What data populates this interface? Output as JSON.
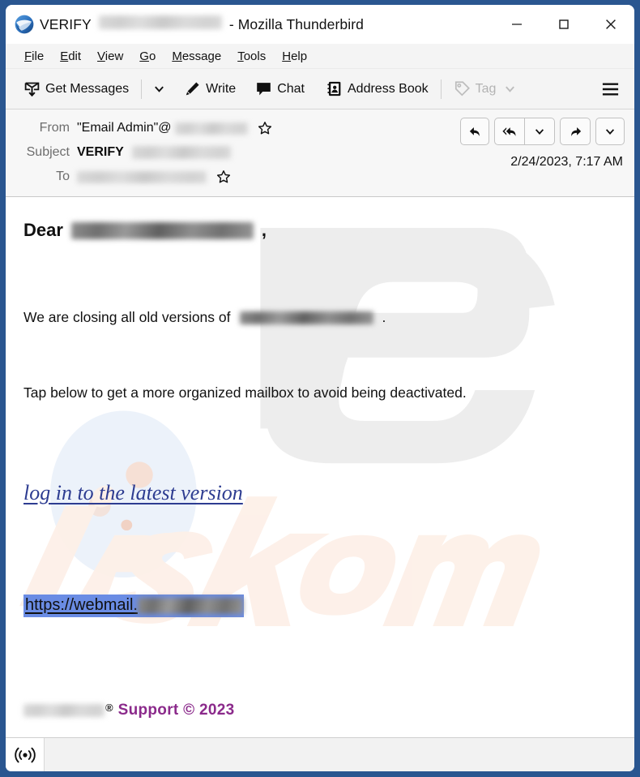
{
  "window": {
    "title_prefix": "VERIFY",
    "title_suffix": "- Mozilla Thunderbird",
    "app_icon": "thunderbird-logo-icon",
    "border_color": "#2a5690",
    "controls": {
      "minimize": "minimize-icon",
      "maximize": "maximize-icon",
      "close": "close-icon"
    }
  },
  "menubar": {
    "items": [
      {
        "label": "File",
        "accel": "F"
      },
      {
        "label": "Edit",
        "accel": "E"
      },
      {
        "label": "View",
        "accel": "V"
      },
      {
        "label": "Go",
        "accel": "G"
      },
      {
        "label": "Message",
        "accel": "M"
      },
      {
        "label": "Tools",
        "accel": "T"
      },
      {
        "label": "Help",
        "accel": "H"
      }
    ]
  },
  "toolbar": {
    "get_messages": "Get Messages",
    "get_messages_icon": "download-mail-icon",
    "get_messages_caret": "chevron-down-icon",
    "write": "Write",
    "write_icon": "pencil-icon",
    "chat": "Chat",
    "chat_icon": "speech-bubble-icon",
    "address_book": "Address Book",
    "address_book_icon": "address-book-icon",
    "tag": "Tag",
    "tag_icon": "tag-icon",
    "tag_caret": "chevron-down-icon",
    "tag_disabled": true,
    "app_menu_icon": "hamburger-menu-icon"
  },
  "message_header": {
    "from_label": "From",
    "from_value": "\"Email Admin\"@",
    "from_domain_redacted": true,
    "subject_label": "Subject",
    "subject_value": "VERIFY",
    "subject_redacted": true,
    "to_label": "To",
    "to_redacted": true,
    "date": "2/24/2023, 7:17 AM",
    "star_icon": "star-outline-icon",
    "actions": {
      "reply": "reply-icon",
      "reply_all": "reply-all-icon",
      "reply_caret": "chevron-down-icon",
      "forward": "forward-icon",
      "more_caret": "chevron-down-icon"
    }
  },
  "body": {
    "greeting": "Dear",
    "greeting_comma": ",",
    "paragraph1_before": "We are closing all old versions of",
    "paragraph1_after": ".",
    "paragraph2": "Tap below to get a more organized mailbox to avoid being deactivated.",
    "link_text": "log in to the latest version",
    "link_color": "#2d3c91",
    "url_text": "https://webmail.",
    "url_selection_color": "#6a8ce4",
    "footer_registered": "®",
    "footer_support": "Support © 2023",
    "footer_support_color": "#8b2a8b",
    "watermark_text": "PC",
    "watermark_subtext": "risk.com"
  },
  "statusbar": {
    "connection_icon": "broadcast-signal-icon"
  }
}
